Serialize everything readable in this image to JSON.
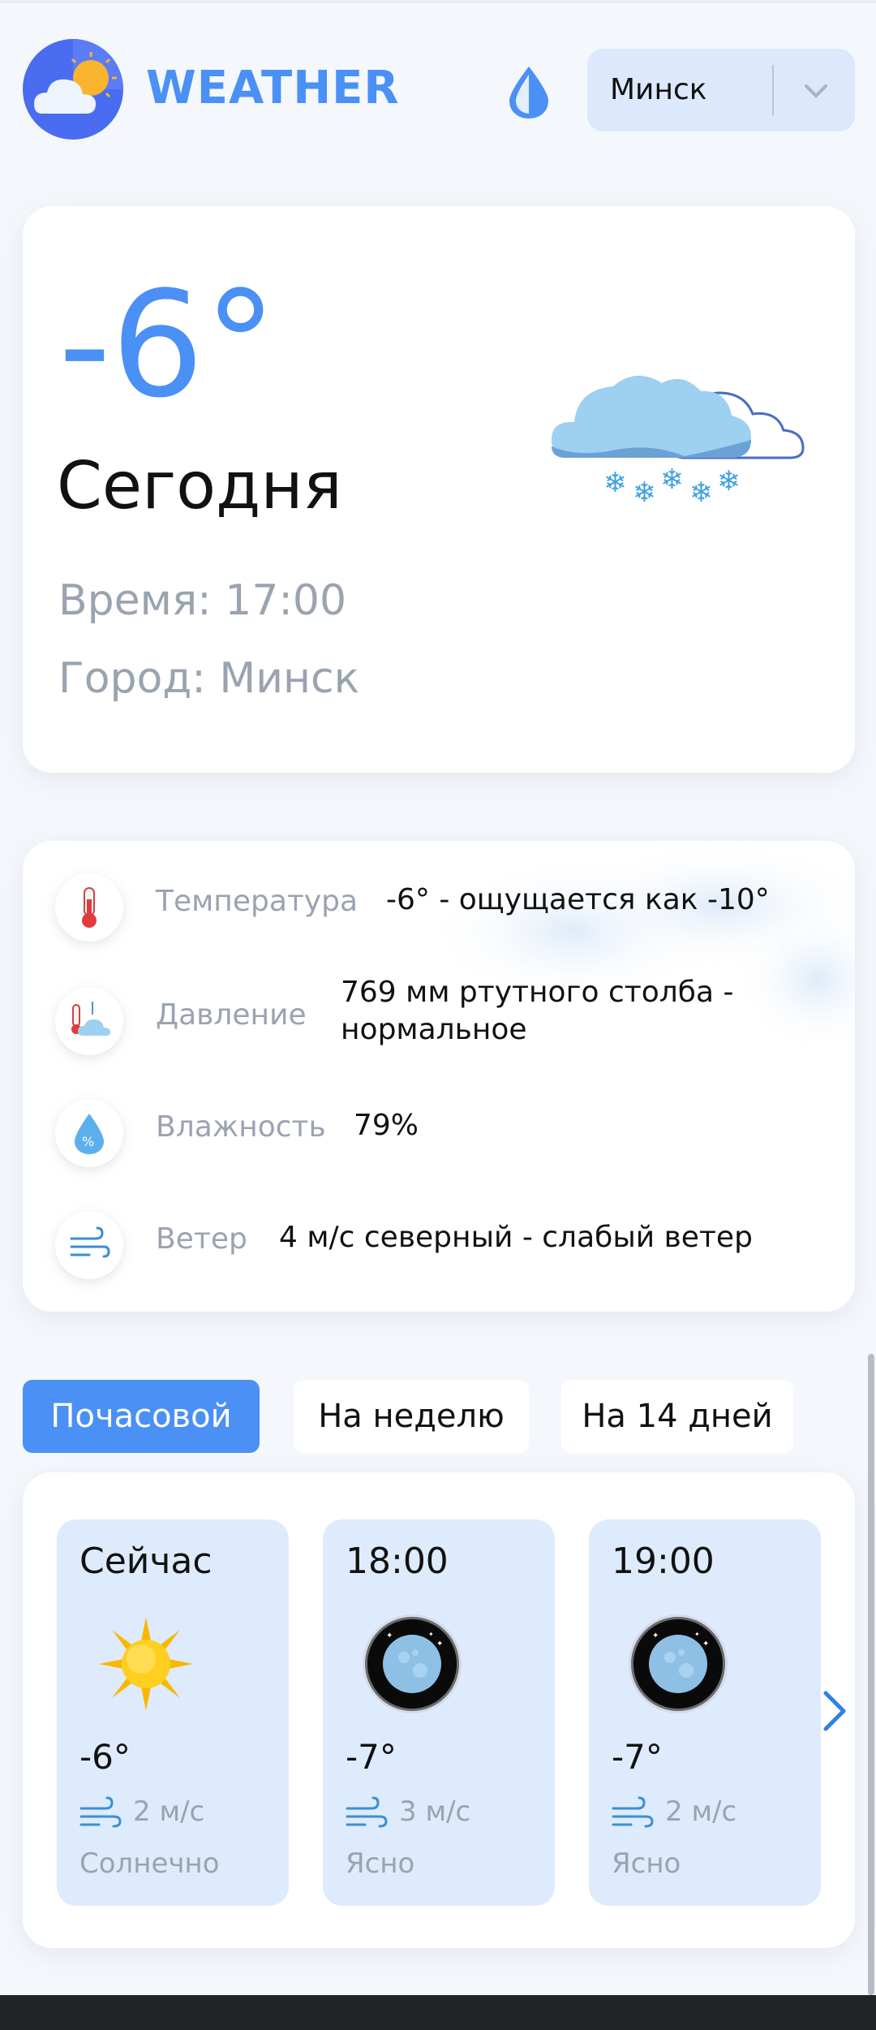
{
  "header": {
    "brand": "WEATHER",
    "city_select": {
      "value": "Минск"
    }
  },
  "current": {
    "temperature": "-6°",
    "day": "Сегодня",
    "time_line": "Время: 17:00",
    "city_line": "Город: Минск",
    "condition_icon": "cloud-snow-icon"
  },
  "details": [
    {
      "label": "Температура",
      "value": "-6° - ощущается как -10°",
      "icon": "thermometer-icon"
    },
    {
      "label": "Давление",
      "value_line1": "769 мм ртутного столба -",
      "value_line2": "нормальное",
      "icon": "pressure-icon"
    },
    {
      "label": "Влажность",
      "value": "79%",
      "icon": "humidity-icon"
    },
    {
      "label": "Ветер",
      "value": "4 м/с северный - слабый ветер",
      "icon": "wind-icon"
    }
  ],
  "tabs": [
    {
      "label": "Почасовой",
      "active": true
    },
    {
      "label": "На неделю",
      "active": false
    },
    {
      "label": "На 14 дней",
      "active": false
    }
  ],
  "hourly": [
    {
      "time": "Сейчас",
      "temp": "-6°",
      "wind": "2 м/с",
      "desc": "Солнечно",
      "icon": "sun-icon"
    },
    {
      "time": "18:00",
      "temp": "-7°",
      "wind": "3 м/с",
      "desc": "Ясно",
      "icon": "moon-icon"
    },
    {
      "time": "19:00",
      "temp": "-7°",
      "wind": "2 м/с",
      "desc": "Ясно",
      "icon": "moon-icon"
    }
  ],
  "colors": {
    "accent": "#4a90f5",
    "muted": "#9aa3b0",
    "card_tint": "#deebfc"
  }
}
